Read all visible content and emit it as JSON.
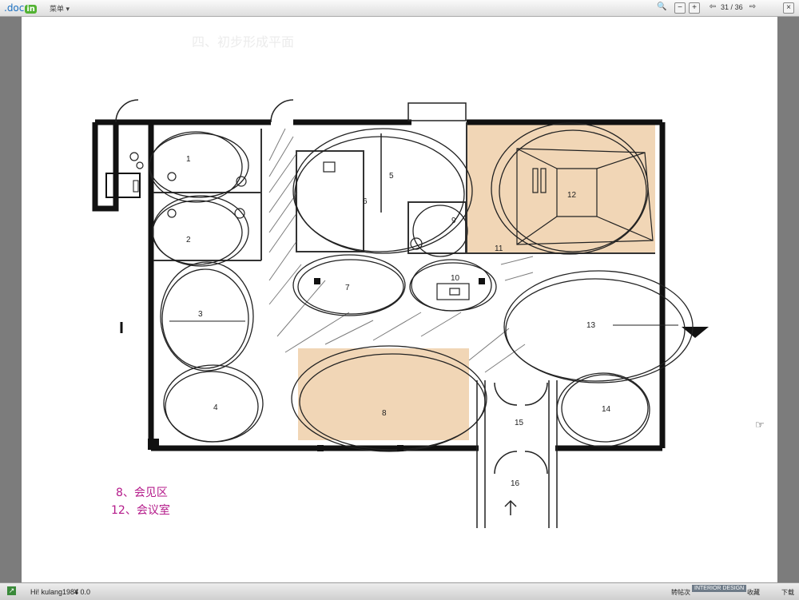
{
  "toolbar": {
    "logo_text": ".doc",
    "logo_badge": "in",
    "menu_label": "菜单",
    "current_page": "31",
    "page_separator": "/",
    "total_pages": "36"
  },
  "page": {
    "title": "四、初步形成平面",
    "legend": [
      "8、会见区",
      "12、会议室"
    ],
    "rooms": [
      "1",
      "2",
      "3",
      "4",
      "5",
      "6",
      "7",
      "8",
      "9",
      "10",
      "11",
      "12",
      "13",
      "14",
      "15",
      "16"
    ]
  },
  "statusbar": {
    "user": "Hi! kulang1984",
    "coins": "¥ 0.0",
    "watermark": "INTERIOR DESIGN",
    "label_a": "转帖次",
    "label_b": "收藏",
    "label_c": "下载"
  },
  "colors": {
    "highlight": "#f1d6b6",
    "legend": "#b41a8a",
    "brand": "#52b232"
  }
}
